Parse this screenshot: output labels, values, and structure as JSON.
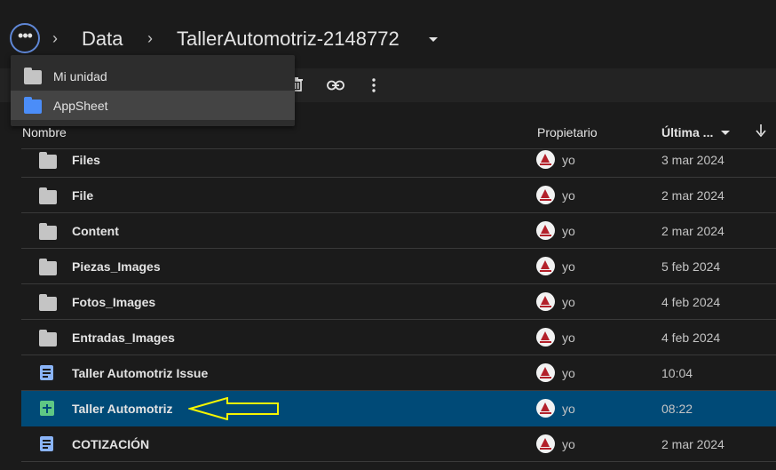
{
  "breadcrumb": {
    "root": "Data",
    "current": "TallerAutomotriz-2148772"
  },
  "menu": {
    "items": [
      {
        "label": "Mi unidad",
        "icon": "folder-icon",
        "color": "#c4c4c4"
      },
      {
        "label": "AppSheet",
        "icon": "folder-icon",
        "color": "#4b8df8"
      }
    ]
  },
  "toolbar": {
    "icons": [
      "trash-icon",
      "link-icon",
      "more-vert-icon"
    ]
  },
  "table": {
    "headers": {
      "name": "Nombre",
      "owner": "Propietario",
      "modified": "Última ...",
      "sort_icon": "arrow-down-icon"
    },
    "rows": [
      {
        "name": "Files",
        "type": "folder",
        "owner": "yo",
        "date": "3 mar 2024"
      },
      {
        "name": "File",
        "type": "folder",
        "owner": "yo",
        "date": "2 mar 2024"
      },
      {
        "name": "Content",
        "type": "folder",
        "owner": "yo",
        "date": "2 mar 2024"
      },
      {
        "name": "Piezas_Images",
        "type": "folder",
        "owner": "yo",
        "date": "5 feb 2024"
      },
      {
        "name": "Fotos_Images",
        "type": "folder",
        "owner": "yo",
        "date": "4 feb 2024"
      },
      {
        "name": "Entradas_Images",
        "type": "folder",
        "owner": "yo",
        "date": "4 feb 2024"
      },
      {
        "name": "Taller Automotriz Issue",
        "type": "doc",
        "owner": "yo",
        "date": "10:04"
      },
      {
        "name": "Taller Automotriz",
        "type": "sheet",
        "owner": "yo",
        "date": "08:22",
        "selected": true
      },
      {
        "name": "COTIZACIÓN",
        "type": "doc",
        "owner": "yo",
        "date": "2 mar 2024"
      }
    ]
  },
  "colors": {
    "background": "#1b1b1b",
    "selected_row": "#004a77",
    "annotation_arrow": "#f5f500",
    "folder_accent": "#4b8df8"
  }
}
